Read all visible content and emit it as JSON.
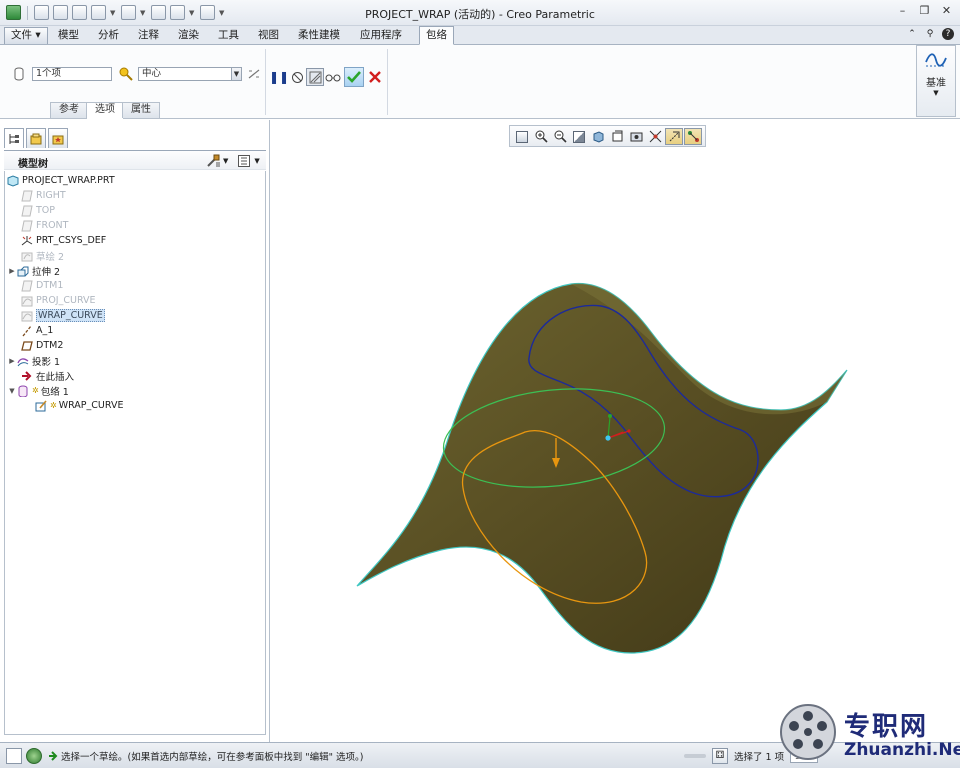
{
  "window": {
    "title": "PROJECT_WRAP (活动的) - Creo Parametric"
  },
  "ribbon_tabs": [
    {
      "label": "文件",
      "kind": "file"
    },
    {
      "label": "模型"
    },
    {
      "label": "分析"
    },
    {
      "label": "注释"
    },
    {
      "label": "渲染"
    },
    {
      "label": "工具"
    },
    {
      "label": "视图"
    },
    {
      "label": "柔性建模"
    },
    {
      "label": "应用程序"
    },
    {
      "label": "包络",
      "active": true
    }
  ],
  "ribbon": {
    "sketch_field_value": "1个项",
    "anchor_value": "中心",
    "subtabs": [
      "参考",
      "选项",
      "属性"
    ],
    "active_subtab": "选项",
    "basis_label": "基准"
  },
  "model_tree": {
    "title": "模型树",
    "nodes": [
      {
        "label": "PROJECT_WRAP.PRT",
        "icon": "part-icon",
        "dim": false
      },
      {
        "label": "RIGHT",
        "icon": "datum-plane-icon",
        "dim": true
      },
      {
        "label": "TOP",
        "icon": "datum-plane-icon",
        "dim": true
      },
      {
        "label": "FRONT",
        "icon": "datum-plane-icon",
        "dim": true
      },
      {
        "label": "PRT_CSYS_DEF",
        "icon": "csys-icon",
        "dim": false
      },
      {
        "label": "草绘 2",
        "icon": "sketch-icon",
        "dim": true
      },
      {
        "label": "拉伸 2",
        "icon": "extrude-icon",
        "dim": false,
        "expandable": true
      },
      {
        "label": "DTM1",
        "icon": "datum-plane-icon",
        "dim": true
      },
      {
        "label": "PROJ_CURVE",
        "icon": "curve-icon",
        "dim": true
      },
      {
        "label": "WRAP_CURVE",
        "icon": "curve-icon",
        "dim": true,
        "selected": true
      },
      {
        "label": "A_1",
        "icon": "axis-icon",
        "dim": false
      },
      {
        "label": "DTM2",
        "icon": "datum-plane-icon",
        "dim": false
      },
      {
        "label": "投影 1",
        "icon": "project-icon",
        "dim": false,
        "expandable": true
      },
      {
        "label": "在此插入",
        "icon": "insert-here-icon",
        "dim": false
      },
      {
        "label": "包络 1",
        "icon": "wrap-icon",
        "dim": false,
        "expandable": true,
        "expanded": true
      },
      {
        "label": "WRAP_CURVE",
        "icon": "sketch-edit-icon",
        "dim": false,
        "child": true
      }
    ]
  },
  "status": {
    "message": "选择一个草绘。(如果首选内部草绘，可在参考面板中找到 \"编辑\" 选项。)",
    "selection": "选择了 1 项",
    "filter": "全部"
  },
  "watermark": {
    "cn": "专职网",
    "en": "Zhuanzhi.Net"
  },
  "colors": {
    "surface": "#5b5225",
    "surface_edge": "#3fc7c2",
    "blue_curve": "#1c2a9a",
    "green_curve": "#3cbf54",
    "orange_curve": "#e8960f",
    "accept": "#2aa52a",
    "cancel": "#d21e1e"
  }
}
